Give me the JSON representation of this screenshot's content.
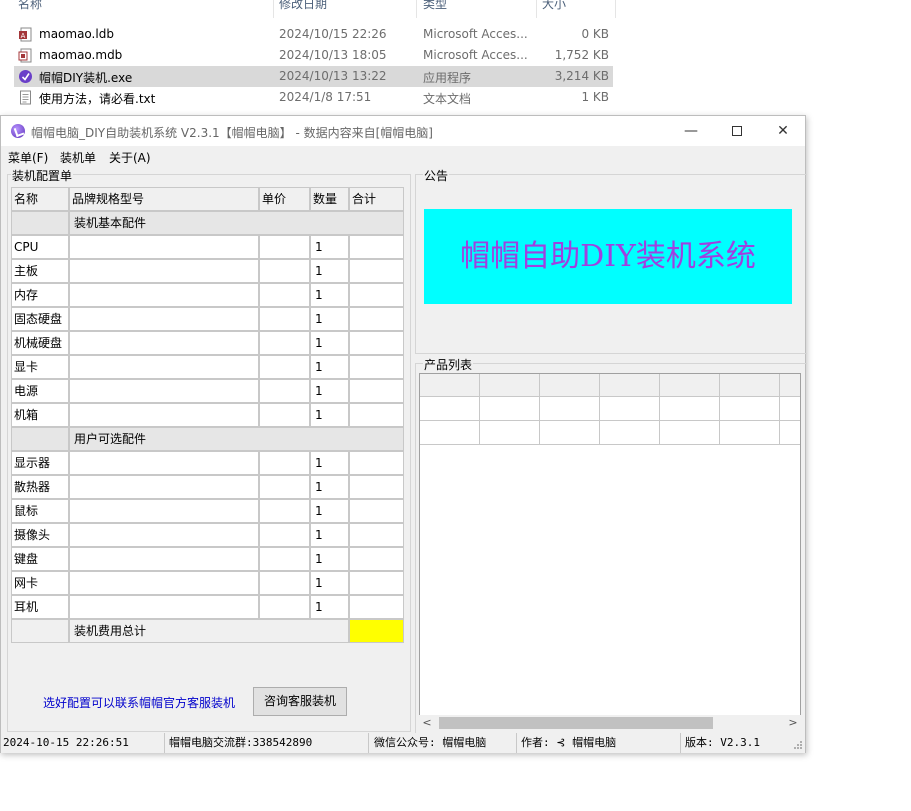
{
  "explorer": {
    "columns": {
      "name": "名称",
      "date": "修改日期",
      "type": "类型",
      "size": "大小"
    },
    "files": [
      {
        "name": "maomao.ldb",
        "date": "2024/10/15 22:26",
        "type": "Microsoft Acces...",
        "size": "0 KB",
        "icon": "access-lock-file-icon"
      },
      {
        "name": "maomao.mdb",
        "date": "2024/10/13 18:05",
        "type": "Microsoft Acces...",
        "size": "1,752 KB",
        "icon": "access-database-icon"
      },
      {
        "name": "帽帽DIY装机.exe",
        "date": "2024/10/13 13:22",
        "type": "应用程序",
        "size": "3,214 KB",
        "icon": "app-executable-icon"
      },
      {
        "name": "使用方法，请必看.txt",
        "date": "2024/1/8 17:51",
        "type": "文本文档",
        "size": "1 KB",
        "icon": "text-document-icon"
      }
    ]
  },
  "window": {
    "title": "帽帽电脑_DIY自助装机系统  V2.3.1【帽帽电脑】 - 数据内容来自[帽帽电脑]",
    "min_glyph": "—",
    "close_glyph": "✕",
    "menu": [
      "菜单(F)",
      "装机单",
      "关于(A)"
    ]
  },
  "config": {
    "group_title": "装机配置单",
    "headers": {
      "name": "名称",
      "spec": "品牌规格型号",
      "price": "单价",
      "qty": "数量",
      "total": "合计"
    },
    "basic_section": "装机基本配件",
    "basic_items": [
      {
        "name": "CPU",
        "qty": "1"
      },
      {
        "name": "主板",
        "qty": "1"
      },
      {
        "name": "内存",
        "qty": "1"
      },
      {
        "name": "固态硬盘",
        "qty": "1"
      },
      {
        "name": "机械硬盘",
        "qty": "1"
      },
      {
        "name": "显卡",
        "qty": "1"
      },
      {
        "name": "电源",
        "qty": "1"
      },
      {
        "name": "机箱",
        "qty": "1"
      }
    ],
    "optional_section": "用户可选配件",
    "optional_items": [
      {
        "name": "显示器",
        "qty": "1"
      },
      {
        "name": "散热器",
        "qty": "1"
      },
      {
        "name": "鼠标",
        "qty": "1"
      },
      {
        "name": "摄像头",
        "qty": "1"
      },
      {
        "name": "键盘",
        "qty": "1"
      },
      {
        "name": "网卡",
        "qty": "1"
      },
      {
        "name": "耳机",
        "qty": "1"
      }
    ],
    "summary_label": "装机费用总计",
    "hint": "选好配置可以联系帽帽官方客服装机",
    "consult_button": "咨询客服装机"
  },
  "announcement": {
    "group_title": "公告",
    "banner_text": "帽帽自助DIY装机系统"
  },
  "products": {
    "group_title": "产品列表",
    "scroll_left": "<",
    "scroll_right": ">"
  },
  "statusbar": {
    "datetime": "2024-10-15 22:26:51",
    "group": "帽帽电脑交流群:338542890",
    "wechat": "微信公众号: 帽帽电脑",
    "author": "作者: ⊰ 帽帽电脑",
    "version": "版本: V2.3.1"
  },
  "colors": {
    "banner_bg": "#00ffff",
    "banner_text": "#a040e0",
    "total_highlight": "#ffff00",
    "hint_text": "#0000cc"
  }
}
